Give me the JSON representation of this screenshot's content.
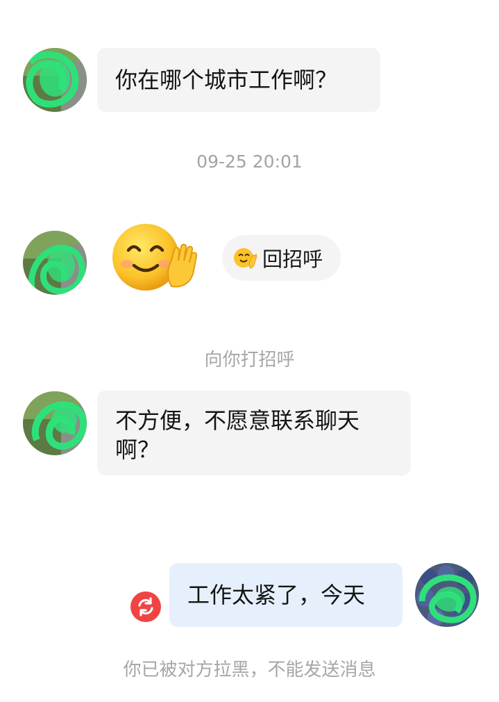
{
  "messages": [
    {
      "text": "你在哪个城市工作啊？"
    },
    {
      "text": "不方便，不愿意联系聊天啊？"
    },
    {
      "text": "工作太紧了，今天"
    }
  ],
  "timestamp": "09-25 20:01",
  "greeting": {
    "sticker_icon": "smiling-waving-hand-emoji-icon",
    "reply_button_label": "回招呼",
    "notice": "向你打招呼"
  },
  "status": {
    "resend_icon": "resend-icon",
    "resend_color": "#f04444",
    "blocked_notice": "你已被对方拉黑，不能发送消息"
  },
  "colors": {
    "incoming_bubble": "#f4f4f4",
    "outgoing_bubble": "#e6f0fd",
    "system_text": "#a6a6a6"
  }
}
